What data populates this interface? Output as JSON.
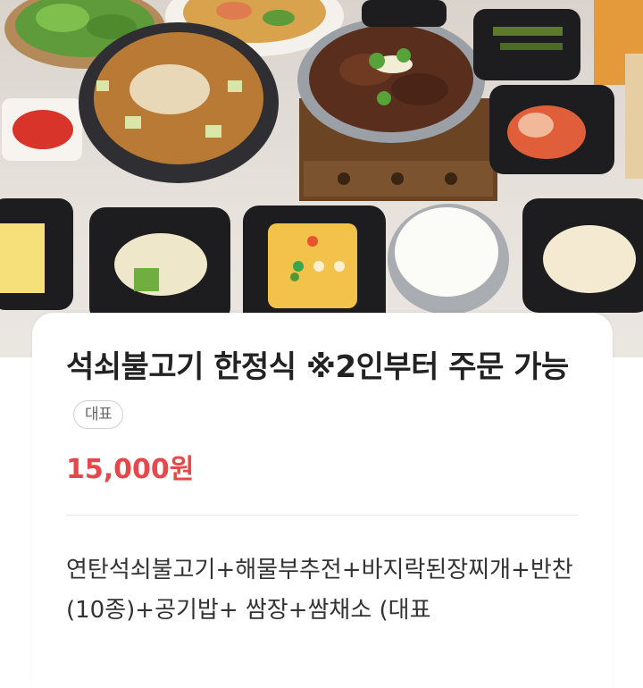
{
  "gallery": {
    "dot_count": 3,
    "active_index": 0,
    "accent_color": "#3aa64a"
  },
  "menu_item": {
    "title": "석쇠불고기 한정식 ※2인부터 주문 가능",
    "badge": "대표",
    "price": "15,000원",
    "price_color": "#e8474a",
    "description": "연탄석쇠불고기+해물부추전+바지락된장찌개+반찬(10종)+공기밥+ 쌈장+쌈채소 (대표"
  }
}
